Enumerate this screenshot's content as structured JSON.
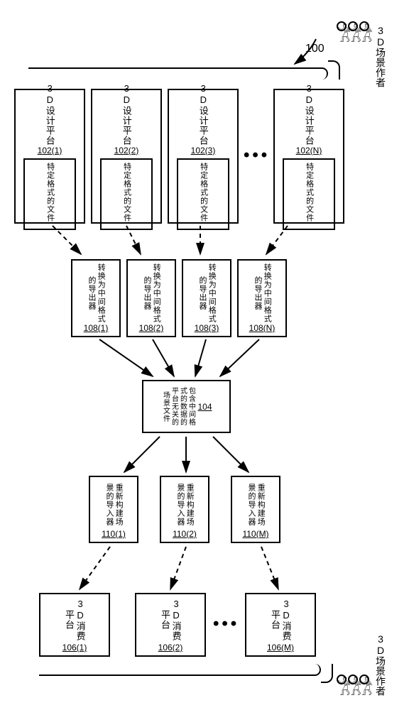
{
  "fig_ref": "100",
  "people_label_top": "3D场景作者",
  "people_label_bottom": "3D场景作者",
  "design_platforms": {
    "title": "3D设计平台",
    "refs": [
      "102(1)",
      "102(2)",
      "102(3)",
      "102(N)"
    ],
    "inner_title": "特定格式的文件"
  },
  "exporters": {
    "title": "转换为中间格式的导出器",
    "refs": [
      "108(1)",
      "108(2)",
      "108(3)",
      "108(N)"
    ]
  },
  "scene_file": {
    "title": "包含中间格式的数据的平台无关的场景文件",
    "ref": "104"
  },
  "importers": {
    "title": "重新构建场景的导入器",
    "refs": [
      "110(1)",
      "110(2)",
      "110(M)"
    ]
  },
  "consumer_platforms": {
    "title": "3D消费平台",
    "refs": [
      "106(1)",
      "106(2)",
      "106(M)"
    ]
  },
  "chart_data": {
    "type": "diagram",
    "description": "System architecture flow diagram",
    "nodes": [
      {
        "id": "102(1..N)",
        "label": "3D设计平台 / 特定格式的文件",
        "layer": 1
      },
      {
        "id": "108(1..N)",
        "label": "转换为中间格式的导出器",
        "layer": 2
      },
      {
        "id": "104",
        "label": "包含中间格式的数据的平台无关的场景文件",
        "layer": 3
      },
      {
        "id": "110(1..M)",
        "label": "重新构建场景的导入器",
        "layer": 4
      },
      {
        "id": "106(1..M)",
        "label": "3D消费平台",
        "layer": 5
      }
    ],
    "edges": [
      {
        "from": "102(1)",
        "to": "108(1)",
        "style": "dashed"
      },
      {
        "from": "102(2)",
        "to": "108(2)",
        "style": "dashed"
      },
      {
        "from": "102(3)",
        "to": "108(3)",
        "style": "dashed"
      },
      {
        "from": "102(N)",
        "to": "108(N)",
        "style": "dashed"
      },
      {
        "from": "108(1)",
        "to": "104",
        "style": "solid"
      },
      {
        "from": "108(2)",
        "to": "104",
        "style": "solid"
      },
      {
        "from": "108(3)",
        "to": "104",
        "style": "solid"
      },
      {
        "from": "108(N)",
        "to": "104",
        "style": "solid"
      },
      {
        "from": "104",
        "to": "110(1)",
        "style": "solid"
      },
      {
        "from": "104",
        "to": "110(2)",
        "style": "solid"
      },
      {
        "from": "104",
        "to": "110(M)",
        "style": "solid"
      },
      {
        "from": "110(1)",
        "to": "106(1)",
        "style": "dashed"
      },
      {
        "from": "110(2)",
        "to": "106(2)",
        "style": "dashed"
      },
      {
        "from": "110(M)",
        "to": "106(M)",
        "style": "dashed"
      }
    ],
    "actors": [
      {
        "label": "3D场景作者",
        "connects": "102",
        "side": "top"
      },
      {
        "label": "3D场景作者",
        "connects": "106",
        "side": "bottom"
      }
    ]
  }
}
